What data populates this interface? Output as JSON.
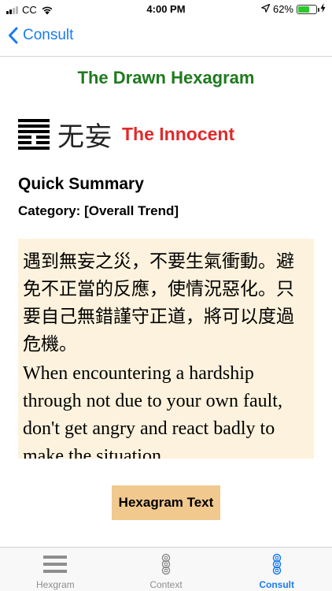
{
  "status_bar": {
    "carrier": "CC",
    "time": "4:00 PM",
    "battery_percent": "62%",
    "battery_level": 0.62
  },
  "nav": {
    "back_label": "Consult"
  },
  "page_title": "The Drawn Hexagram",
  "hexagram": {
    "chinese_name": "无妄",
    "english_name": "The Innocent",
    "lines_top_to_bottom": [
      "solid",
      "solid",
      "solid",
      "broken",
      "broken",
      "solid"
    ]
  },
  "summary": {
    "heading": "Quick Summary",
    "category": "Category: [Overall Trend]",
    "chinese_text": "遇到無妄之災，不要生氣衝動。避免不正當的反應，使情況惡化。只要自己無錯謹守正道，將可以度過危機。",
    "english_text": "When encountering a hardship through not due to your own fault, don't get angry and react badly to make the situation"
  },
  "buttons": {
    "hexagram_text": "Hexagram Text"
  },
  "tab_bar": {
    "tabs": [
      {
        "label": "Hexgram",
        "icon": "hexagram-lines-icon",
        "active": false
      },
      {
        "label": "Context",
        "icon": "coins-icon",
        "active": false
      },
      {
        "label": "Consult",
        "icon": "coins-icon",
        "active": true
      }
    ]
  },
  "colors": {
    "accent_blue": "#1a7bf2",
    "title_green": "#1f7a1f",
    "name_red": "#e02a2a",
    "summary_bg": "#fdf2dd",
    "button_bg": "#f1c98e"
  }
}
